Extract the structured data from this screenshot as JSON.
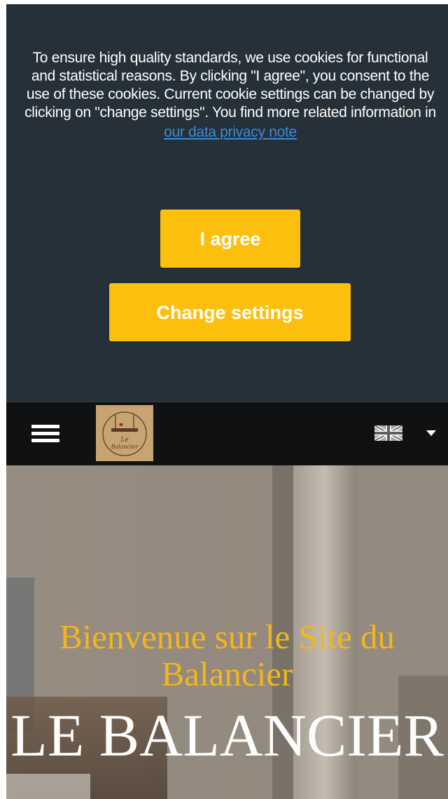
{
  "cookie_banner": {
    "message": "To ensure high quality standards, we use cookies for functional and statistical reasons. By clicking \"I agree\", you consent to the use of these cookies. Current cookie settings can be changed by clicking on \"change settings\". You find more related information in",
    "privacy_link": "our data privacy note",
    "agree_label": "I agree",
    "settings_label": "Change settings",
    "background": "#253038",
    "button_color": "#fcbf0e",
    "link_color": "#3b8bd9"
  },
  "navbar": {
    "menu_icon": "hamburger-menu-icon",
    "logo_icon": "le-balancier-logo",
    "language_icon": "uk-flag-icon",
    "dropdown_icon": "caret-down-icon",
    "logo_text": "Le Balancier"
  },
  "hero": {
    "welcome": "Bienvenue sur le Site du Balancier",
    "title": "LE BALANCIER",
    "welcome_color": "#f3b61c"
  }
}
